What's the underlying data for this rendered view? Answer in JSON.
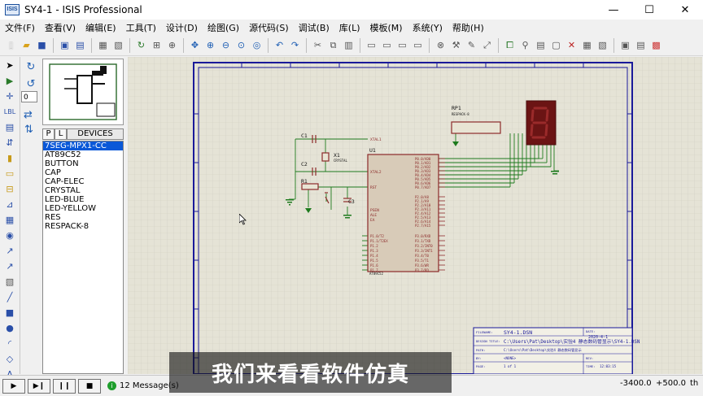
{
  "window": {
    "title": "SY4-1 - ISIS Professional",
    "app_badge": "ISIS",
    "minimize": "—",
    "maximize": "☐",
    "close": "✕"
  },
  "menu": [
    {
      "label": "文件(F)"
    },
    {
      "label": "查看(V)"
    },
    {
      "label": "编辑(E)"
    },
    {
      "label": "工具(T)"
    },
    {
      "label": "设计(D)"
    },
    {
      "label": "绘图(G)"
    },
    {
      "label": "源代码(S)"
    },
    {
      "label": "调试(B)"
    },
    {
      "label": "库(L)"
    },
    {
      "label": "模板(M)"
    },
    {
      "label": "系统(Y)"
    },
    {
      "label": "帮助(H)"
    }
  ],
  "left_panel": {
    "angle_value": "0",
    "tab_p": "P",
    "tab_l": "L",
    "devices_header": "DEVICES",
    "devices": [
      {
        "name": "7SEG-MPX1-CC",
        "selected": true
      },
      {
        "name": "AT89C52",
        "selected": false
      },
      {
        "name": "BUTTON",
        "selected": false
      },
      {
        "name": "CAP",
        "selected": false
      },
      {
        "name": "CAP-ELEC",
        "selected": false
      },
      {
        "name": "CRYSTAL",
        "selected": false
      },
      {
        "name": "LED-BLUE",
        "selected": false
      },
      {
        "name": "LED-YELLOW",
        "selected": false
      },
      {
        "name": "RES",
        "selected": false
      },
      {
        "name": "RESPACK-8",
        "selected": false
      }
    ]
  },
  "schematic": {
    "labels": {
      "c1": "C1",
      "c2": "C2",
      "c3": "C3",
      "r1": "R1",
      "x1": "X1",
      "x1_type": "CRYSTAL",
      "u1": "U1",
      "u1_part": "AT89C52",
      "rp1": "RP1",
      "rp1_part": "RESPACK-8",
      "xtal1": "XTAL1",
      "xtal2": "XTAL2",
      "rst": "RST",
      "psen": "PSEN",
      "ale": "ALE",
      "ea": "EA"
    },
    "title_block": {
      "filename_label": "FILENAME:",
      "filename": "SY4-1.DSN",
      "design_title_label": "DESIGN TITLE:",
      "design_title": "C:\\Users\\Pat\\Desktop\\实验4 静态数码管显示\\SY4-1.DSN",
      "path_label": "PATH:",
      "path": "C:\\Users\\Pat\\Desktop\\实验4 静态数码管显示",
      "by_label": "BY:",
      "by": "<NONE>",
      "rev_label": "REV:",
      "date_label": "DATE:",
      "date": "2020-4-1",
      "page_label": "PAGE:",
      "page": "1 of 1",
      "time_label": "TIME:",
      "time": "12:03:15"
    }
  },
  "status": {
    "messages": "12 Message(s)",
    "coord_x": "-3400.0",
    "coord_y": "+500.0",
    "unit": "th"
  },
  "overlay": {
    "subtitle": "我们来看看软件仿真"
  },
  "colors": {
    "canvas_bg": "#e5e3d6",
    "grid": "#cfcdbf",
    "sheet_border": "#1a1a9a",
    "component": "#8c2a2a",
    "wire": "#1d7a1d",
    "selection_blue": "#0a58d8"
  }
}
